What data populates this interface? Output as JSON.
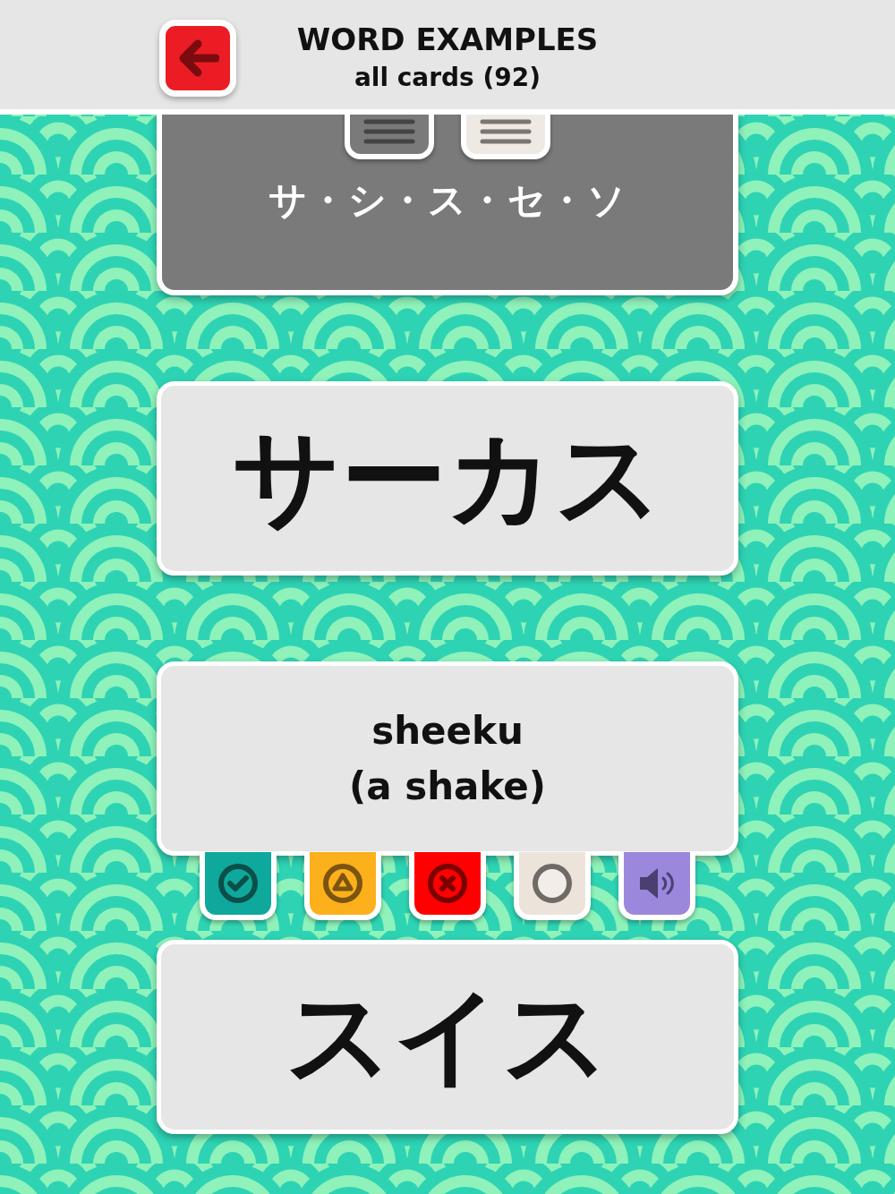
{
  "header": {
    "title": "WORD EXAMPLES",
    "subtitle": "all cards (92)"
  },
  "top_card": {
    "text": "サ・シ・ス・セ・ソ",
    "tabs": [
      {
        "selected": true
      },
      {
        "selected": false
      }
    ]
  },
  "cards": [
    {
      "kind": "word",
      "text": "サーカス"
    },
    {
      "kind": "meaning",
      "text": "sheeku\n(a shake)"
    }
  ],
  "status_buttons": [
    {
      "kind": "check"
    },
    {
      "kind": "triangle"
    },
    {
      "kind": "cross"
    },
    {
      "kind": "circle"
    },
    {
      "kind": "sound"
    }
  ],
  "next_card": {
    "text": "スイス"
  }
}
